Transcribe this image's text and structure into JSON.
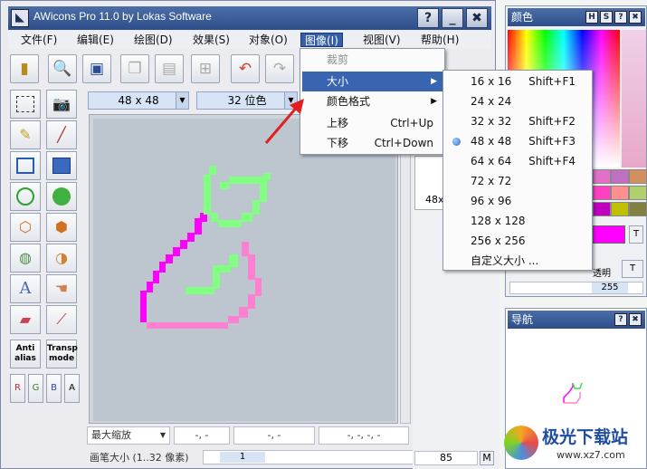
{
  "window": {
    "title": "AWicons Pro 11.0 by Lokas Software",
    "help_btn": "?",
    "min_btn": "_",
    "close_btn": "✖"
  },
  "menu": [
    "文件(F)",
    "编辑(E)",
    "绘图(D)",
    "效果(S)",
    "对象(O)",
    "图像(I)",
    "视图(V)",
    "帮助(H)"
  ],
  "toolbar_icons": [
    "open-icon",
    "zoom-icon",
    "save-icon",
    "copy-icon",
    "paste-icon",
    "new-icon",
    "undo-icon",
    "redo-icon"
  ],
  "image_size_select": "48 x 48",
  "color_depth_select": "32 位色",
  "context_menu": {
    "items": [
      {
        "label": "裁剪",
        "disabled": true
      },
      {
        "label": "大小",
        "highlight": true,
        "submenu": true
      },
      {
        "label": "颜色格式",
        "submenu": true
      },
      {
        "label": "上移",
        "shortcut": "Ctrl+Up"
      },
      {
        "label": "下移",
        "shortcut": "Ctrl+Down"
      }
    ]
  },
  "size_submenu": [
    {
      "label": "16 x 16",
      "shortcut": "Shift+F1"
    },
    {
      "label": "24 x 24",
      "shortcut": ""
    },
    {
      "label": "32 x 32",
      "shortcut": "Shift+F2"
    },
    {
      "label": "48 x 48",
      "shortcut": "Shift+F3",
      "checked": true
    },
    {
      "label": "64 x 64",
      "shortcut": "Shift+F4"
    },
    {
      "label": "72 x 72",
      "shortcut": ""
    },
    {
      "label": "96 x 96",
      "shortcut": ""
    },
    {
      "label": "128 x 128",
      "shortcut": ""
    },
    {
      "label": "256 x 256",
      "shortcut": ""
    },
    {
      "label": "自定义大小 ...",
      "shortcut": ""
    }
  ],
  "tools": [
    "Anti alias",
    "Transp mode",
    "R",
    "G",
    "B",
    "A"
  ],
  "status": {
    "zoom": "最大缩放",
    "pos1": "-, -",
    "pos2": "-, -",
    "pos3": "-, -, -, -",
    "brush_label": "画笔大小 (1..32 像素)",
    "brush_value": "1",
    "mid_value": "85",
    "mid_m": "M"
  },
  "color_panel": {
    "title": "颜色",
    "btn_h": "H",
    "btn_s": "S",
    "btn_help": "?",
    "btn_close": "✖",
    "value": "255",
    "t_label": "T",
    "opacity_label": "透明"
  },
  "nav_panel": {
    "title": "导航",
    "btn_help": "?",
    "btn_close": "✖"
  },
  "mid_label": "48x",
  "watermark": {
    "text": "极光下载站",
    "url": "www.xz7.com"
  },
  "colors": {
    "accent": "#3864b0",
    "title": "#2d4e8a",
    "magenta": "#ff00ff",
    "pink": "#ff80d0",
    "green": "#80ff80"
  }
}
